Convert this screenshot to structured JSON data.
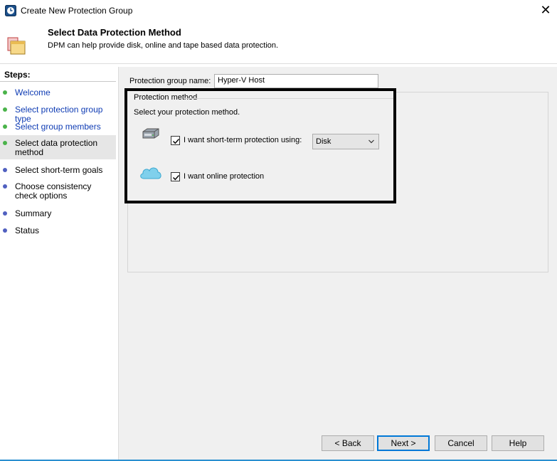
{
  "window": {
    "title": "Create New Protection Group",
    "close_glyph": "✕"
  },
  "header": {
    "title": "Select Data Protection Method",
    "subtitle": "DPM can help provide disk, online and tape based data protection."
  },
  "sidebar": {
    "heading": "Steps:",
    "steps": [
      {
        "label": "Welcome",
        "state": "done"
      },
      {
        "label": "Select protection group type",
        "state": "done"
      },
      {
        "label": "Select group members",
        "state": "done"
      },
      {
        "label": "Select data protection method",
        "state": "current"
      },
      {
        "label": "Select short-term goals",
        "state": "todo"
      },
      {
        "label": "Choose consistency check options",
        "state": "todo"
      },
      {
        "label": "Summary",
        "state": "todo"
      },
      {
        "label": "Status",
        "state": "todo"
      }
    ]
  },
  "form": {
    "group_name_label": "Protection group name:",
    "group_name_value": "Hyper-V Host",
    "method_legend": "Protection method",
    "instruction": "Select your protection method.",
    "short_term": {
      "label": "I want short-term protection using:",
      "checked": true,
      "icon": "disk-drive-icon"
    },
    "short_term_select": {
      "value": "Disk"
    },
    "online": {
      "label": "I want online protection",
      "checked": true,
      "icon": "cloud-icon"
    }
  },
  "buttons": {
    "back": "< Back",
    "next": "Next >",
    "cancel": "Cancel",
    "help": "Help"
  },
  "colors": {
    "done_link": "#0f3cb4",
    "done_dot": "#4ab34a",
    "todo_dot": "#5060c0",
    "accent": "#0078d7"
  }
}
